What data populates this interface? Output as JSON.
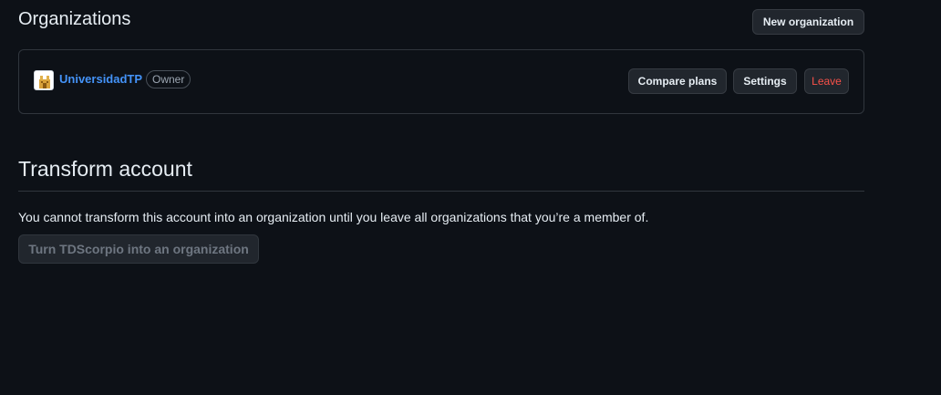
{
  "organizations": {
    "title": "Organizations",
    "new_button": "New organization",
    "items": [
      {
        "name": "UniversidadTP",
        "role": "Owner",
        "avatar_icon": "university-building-icon",
        "actions": {
          "compare": "Compare plans",
          "settings": "Settings",
          "leave": "Leave"
        }
      }
    ]
  },
  "transform": {
    "title": "Transform account",
    "description": "You cannot transform this account into an organization until you leave all organizations that you’re a member of.",
    "button": "Turn TDScorpio into an organization"
  },
  "colors": {
    "background": "#0d1117",
    "link": "#4493f8",
    "danger": "#f85149",
    "border": "#30363d"
  }
}
